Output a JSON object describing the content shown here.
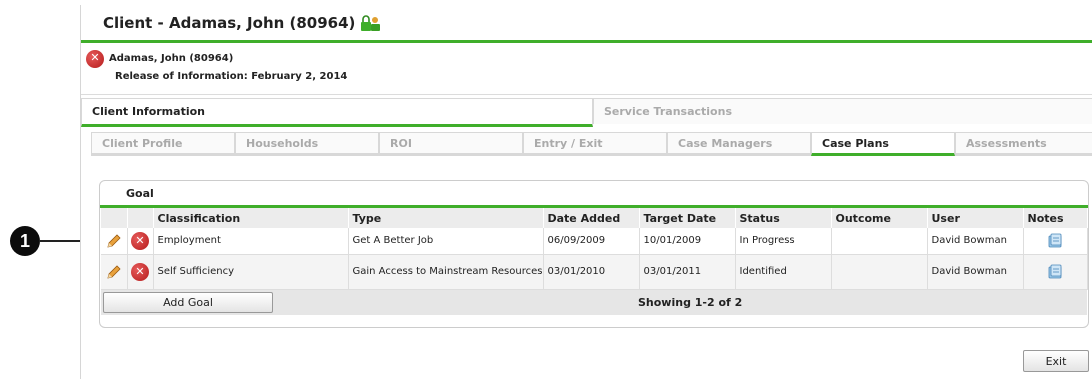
{
  "callout": {
    "number": "1"
  },
  "header": {
    "title": "Client - Adamas, John (80964)"
  },
  "client": {
    "name": "Adamas, John (80964)",
    "release": "Release of Information: February 2, 2014"
  },
  "main_tabs": [
    {
      "label": "Client Information",
      "active": true
    },
    {
      "label": "Service Transactions",
      "active": false
    }
  ],
  "sub_tabs": [
    {
      "label": "Client Profile",
      "active": false
    },
    {
      "label": "Households",
      "active": false
    },
    {
      "label": "ROI",
      "active": false
    },
    {
      "label": "Entry / Exit",
      "active": false
    },
    {
      "label": "Case Managers",
      "active": false
    },
    {
      "label": "Case Plans",
      "active": true
    },
    {
      "label": "Assessments",
      "active": false
    }
  ],
  "goal": {
    "title": "Goal",
    "columns": [
      "Classification",
      "Type",
      "Date Added",
      "Target Date",
      "Status",
      "Outcome",
      "User",
      "Notes"
    ],
    "rows": [
      {
        "classification": "Employment",
        "type": "Get A Better Job",
        "date_added": "06/09/2009",
        "target_date": "10/01/2009",
        "status": "In Progress",
        "outcome": "",
        "user": "David Bowman"
      },
      {
        "classification": "Self Sufficiency",
        "type": "Gain Access to Mainstream Resources",
        "date_added": "03/01/2010",
        "target_date": "03/01/2011",
        "status": "Identified",
        "outcome": "",
        "user": "David Bowman"
      }
    ],
    "add_label": "Add Goal",
    "showing": "Showing 1-2 of 2"
  },
  "exit_label": "Exit",
  "colors": {
    "accent_green": "#3fae2a",
    "delete_red": "#c62828"
  },
  "icons": [
    "lock-icon",
    "delete-icon",
    "edit-pencil-icon",
    "notes-icon"
  ]
}
